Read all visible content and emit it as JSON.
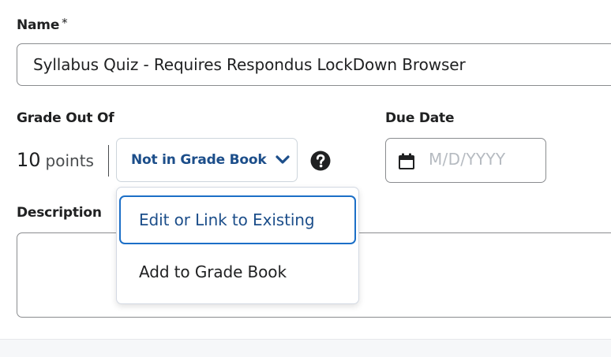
{
  "form": {
    "name_label": "Name",
    "name_required_mark": "*",
    "name_value": "Syllabus Quiz - Requires Respondus LockDown Browser",
    "grade_label": "Grade Out Of",
    "points_value": "10",
    "points_unit": "points",
    "grade_button_label": "Not in Grade Book",
    "due_date_label": "Due Date",
    "due_date_placeholder": "M/D/YYYY",
    "description_label": "Description"
  },
  "dropdown": {
    "items": [
      {
        "label": "Edit or Link to Existing",
        "highlighted": true
      },
      {
        "label": "Add to Grade Book",
        "highlighted": false
      }
    ]
  },
  "icons": {
    "chevron": "chevron-down-icon",
    "help": "help-circle-icon",
    "calendar": "calendar-icon"
  },
  "colors": {
    "accent": "#1c4e8a",
    "focus_ring": "#1c6fc7",
    "text": "#202122",
    "placeholder": "#b6bbc1"
  }
}
